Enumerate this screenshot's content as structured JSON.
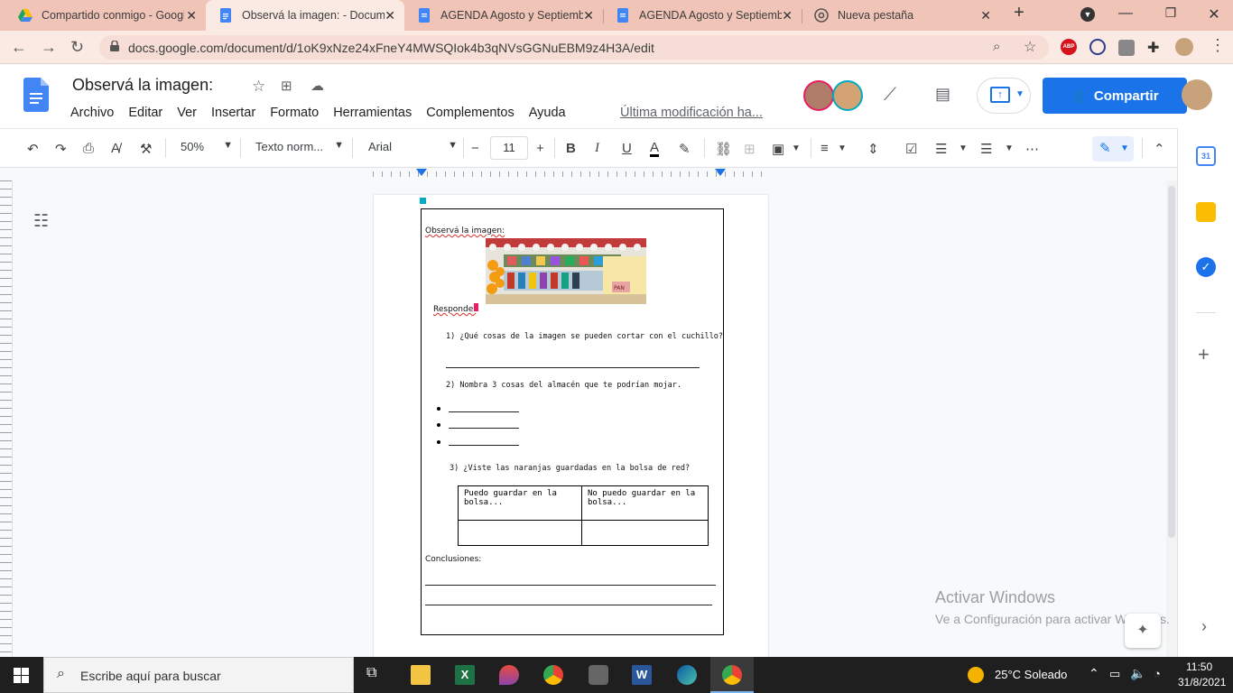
{
  "browser": {
    "tabs": [
      {
        "title": "Compartido conmigo - Googl",
        "active": false
      },
      {
        "title": "Observá la imagen: - Docum",
        "active": true
      },
      {
        "title": "AGENDA Agosto y Septiembr",
        "active": false
      },
      {
        "title": "AGENDA Agosto y Septiembr",
        "active": false
      },
      {
        "title": "Nueva pestaña",
        "active": false
      }
    ],
    "new_tab": "+",
    "url": "docs.google.com/document/d/1oK9xNze24xFneY4MWSQIok4b3qNVsGGNuEBM9z4H3A/edit",
    "ext_abp": "ABP"
  },
  "docs": {
    "title": "Observá la imagen:",
    "menu": [
      "Archivo",
      "Editar",
      "Ver",
      "Insertar",
      "Formato",
      "Herramientas",
      "Complementos",
      "Ayuda"
    ],
    "last_modified": "Última modificación ha...",
    "share_label": "Compartir",
    "toolbar": {
      "zoom": "50%",
      "style": "Texto norm...",
      "font": "Arial",
      "font_size": "11"
    }
  },
  "document": {
    "heading": "Observá la imagen:",
    "responde": "Responde:",
    "q1": "1) ¿Qué cosas de la imagen se pueden cortar con el cuchillo?",
    "q2": "2) Nombra 3 cosas del almacén que te podrían mojar.",
    "q3": "3) ¿Viste las naranjas guardadas en la bolsa de red?",
    "table": {
      "col1": "Puedo guardar en la bolsa...",
      "col2": "No puedo guardar en la bolsa..."
    },
    "conclusions": "Conclusiones:",
    "image_label": "PAN"
  },
  "watermark": {
    "line1": "Activar Windows",
    "line2": "Ve a Configuración para activar Windows."
  },
  "taskbar": {
    "search_placeholder": "Escribe aquí para buscar",
    "weather": "25°C  Soleado",
    "time": "11:50",
    "date": "31/8/2021"
  }
}
